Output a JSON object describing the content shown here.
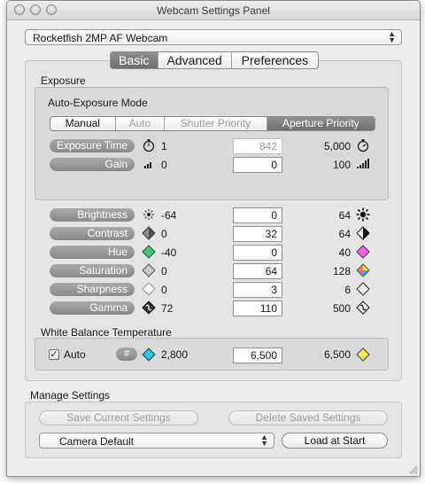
{
  "window": {
    "title": "Webcam Settings Panel"
  },
  "camera_select": {
    "value": "Rocketfish 2MP AF Webcam"
  },
  "tabs": [
    {
      "label": "Basic",
      "selected": true
    },
    {
      "label": "Advanced",
      "selected": false
    },
    {
      "label": "Preferences",
      "selected": false
    }
  ],
  "exposure": {
    "section_label": "Exposure",
    "mode_label": "Auto-Exposure Mode",
    "modes": [
      {
        "label": "Manual",
        "state": "normal"
      },
      {
        "label": "Auto",
        "state": "disabled"
      },
      {
        "label": "Shutter Priority",
        "state": "disabled"
      },
      {
        "label": "Aperture Priority",
        "state": "selected"
      }
    ],
    "rows": [
      {
        "label": "Exposure Time",
        "min": "1",
        "value": "842",
        "max": "5,000",
        "min_icon": "stopwatch-icon",
        "max_icon": "stopwatch-icon",
        "value_disabled": true
      },
      {
        "label": "Gain",
        "min": "0",
        "value": "0",
        "max": "100",
        "min_icon": "signal-low-icon",
        "max_icon": "signal-high-icon",
        "value_disabled": false
      }
    ]
  },
  "controls": [
    {
      "label": "Brightness",
      "min": "-64",
      "value": "0",
      "max": "64",
      "min_icon": "sun-small-icon",
      "max_icon": "sun-large-icon"
    },
    {
      "label": "Contrast",
      "min": "0",
      "value": "32",
      "max": "64",
      "min_icon": "contrast-low-icon",
      "max_icon": "contrast-high-icon"
    },
    {
      "label": "Hue",
      "min": "-40",
      "value": "0",
      "max": "40",
      "min_icon": "green-diamond-icon",
      "max_icon": "magenta-diamond-icon"
    },
    {
      "label": "Saturation",
      "min": "0",
      "value": "64",
      "max": "128",
      "min_icon": "gray-diamond-icon",
      "max_icon": "color-diamond-icon"
    },
    {
      "label": "Sharpness",
      "min": "0",
      "value": "3",
      "max": "6",
      "min_icon": "soft-diamond-icon",
      "max_icon": "sharp-diamond-icon"
    },
    {
      "label": "Gamma",
      "min": "72",
      "value": "110",
      "max": "500",
      "min_icon": "gamma-low-icon",
      "max_icon": "gamma-high-icon"
    }
  ],
  "white_balance": {
    "section_label": "White Balance Temperature",
    "auto_label": "Auto",
    "auto_checked": true,
    "hash_label": "#",
    "min": "2,800",
    "value": "6,500",
    "max": "6,500",
    "min_icon": "cyan-diamond-icon",
    "max_icon": "yellow-diamond-icon"
  },
  "manage": {
    "section_label": "Manage Settings",
    "save_label": "Save Current Settings",
    "delete_label": "Delete Saved Settings",
    "preset_value": "Camera Default",
    "load_label": "Load at Start"
  },
  "colors": {
    "label_pill": "#9a9a9a",
    "selected_segment": "#7d7d7d",
    "hue_min": "#33d17a",
    "hue_max": "#ff5ae6",
    "wb_min": "#22c7e6",
    "wb_max": "#f5f05a"
  }
}
